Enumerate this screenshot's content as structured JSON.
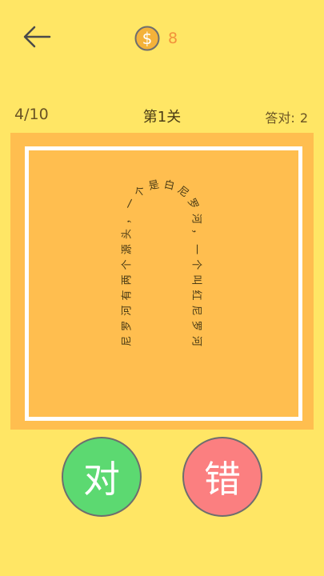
{
  "header": {
    "back_icon": "arrow-left-icon",
    "coin_icon": "dollar-coin-icon",
    "coin_symbol": "$",
    "coins": "8",
    "colors": {
      "coin": "#f2913b",
      "coin_fill": "#f4b23a"
    }
  },
  "stats": {
    "progress": "4/10",
    "level": "第1关",
    "score_label": "答对:",
    "score_value": "2"
  },
  "quote": {
    "text": "尼罗河有两个源头，一个是白尼罗河，一个叫红尼罗河"
  },
  "buttons": {
    "correct": "对",
    "wrong": "错",
    "colors": {
      "correct": "#5cd971",
      "wrong": "#fb7f80"
    }
  },
  "colors": {
    "background": "#ffe665",
    "card": "#ffbe4f",
    "card_border": "#ffffff"
  }
}
